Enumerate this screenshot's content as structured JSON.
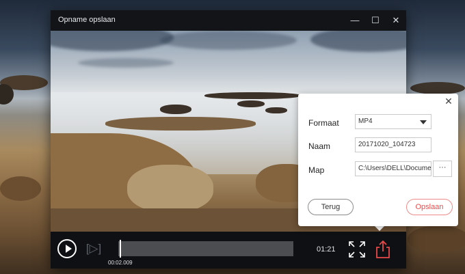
{
  "window": {
    "title": "Opname opslaan",
    "minimize_glyph": "—",
    "maximize_glyph": "☐",
    "close_glyph": "✕"
  },
  "player": {
    "current_time": "00:02.009",
    "duration": "01:21",
    "step_glyph": "[▷]"
  },
  "dialog": {
    "close_glyph": "✕",
    "format_label": "Formaat",
    "format_value": "MP4",
    "name_label": "Naam",
    "name_value": "20171020_104723",
    "folder_label": "Map",
    "folder_value": "C:\\Users\\DELL\\Documents",
    "browse_label": "···",
    "back_label": "Terug",
    "save_label": "Opslaan"
  },
  "colors": {
    "accent_red": "#e84a4a",
    "window_bg": "#0e1014"
  }
}
